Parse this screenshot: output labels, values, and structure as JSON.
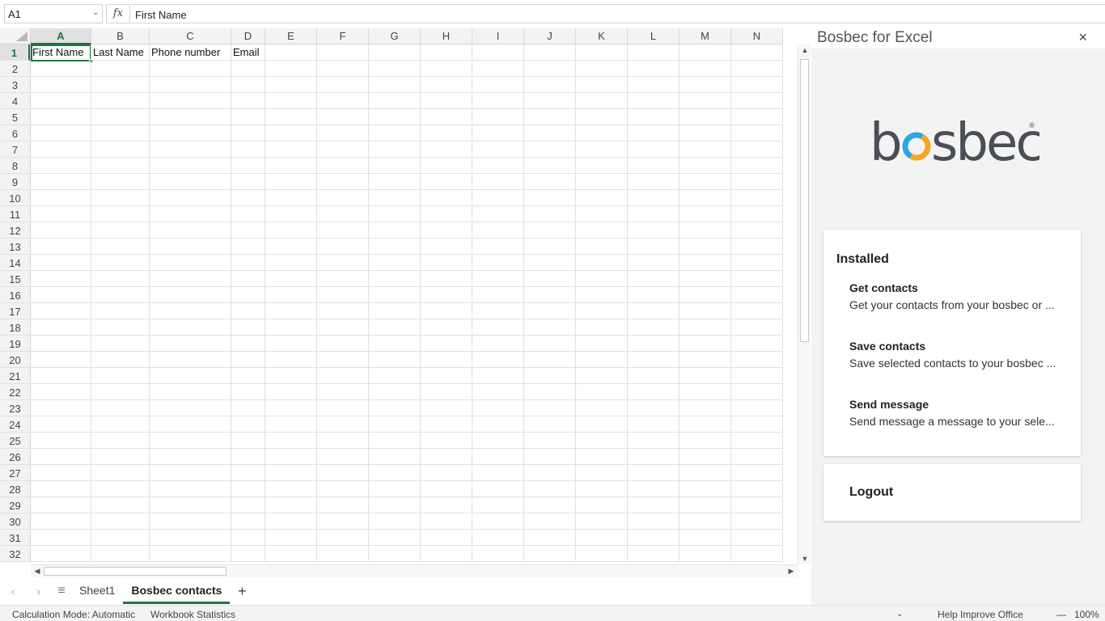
{
  "formula_bar": {
    "name_box": "A1",
    "fx": "fx",
    "formula": "First Name"
  },
  "grid": {
    "columns": [
      "A",
      "B",
      "C",
      "D",
      "E",
      "F",
      "G",
      "H",
      "I",
      "J",
      "K",
      "L",
      "M",
      "N"
    ],
    "rows": [
      "1",
      "2",
      "3",
      "4",
      "5",
      "6",
      "7",
      "8",
      "9",
      "10",
      "11",
      "12",
      "13",
      "14",
      "15",
      "16",
      "17",
      "18",
      "19",
      "20",
      "21",
      "22",
      "23",
      "24",
      "25",
      "26",
      "27",
      "28",
      "29",
      "30",
      "31",
      "32"
    ],
    "cells_row1": [
      "First Name",
      "Last Name",
      "Phone number",
      "Email"
    ]
  },
  "sheet_tabs": {
    "prev": "‹",
    "next": "›",
    "menu": "≡",
    "tabs": [
      "Sheet1",
      "Bosbec contacts"
    ],
    "add": "+"
  },
  "status_bar": {
    "calc_mode": "Calculation Mode: Automatic",
    "workbook_stats": "Workbook Statistics",
    "help_improve": "Help Improve Office",
    "zoom_out": "—",
    "zoom": "100%"
  },
  "task_pane": {
    "title": "Bosbec for Excel",
    "close": "×",
    "logo_text": "bosbec",
    "logo_colors": {
      "text": "#4a4f55",
      "orange": "#f5a623",
      "blue": "#29a9e0"
    },
    "installed": {
      "heading": "Installed",
      "features": [
        {
          "title": "Get contacts",
          "desc": "Get your contacts from your bosbec or ..."
        },
        {
          "title": "Save contacts",
          "desc": "Save selected contacts to your bosbec ..."
        },
        {
          "title": "Send message",
          "desc": "Send message a message to your sele..."
        }
      ]
    },
    "logout": "Logout"
  },
  "colors": {
    "excel_green": "#217346"
  }
}
